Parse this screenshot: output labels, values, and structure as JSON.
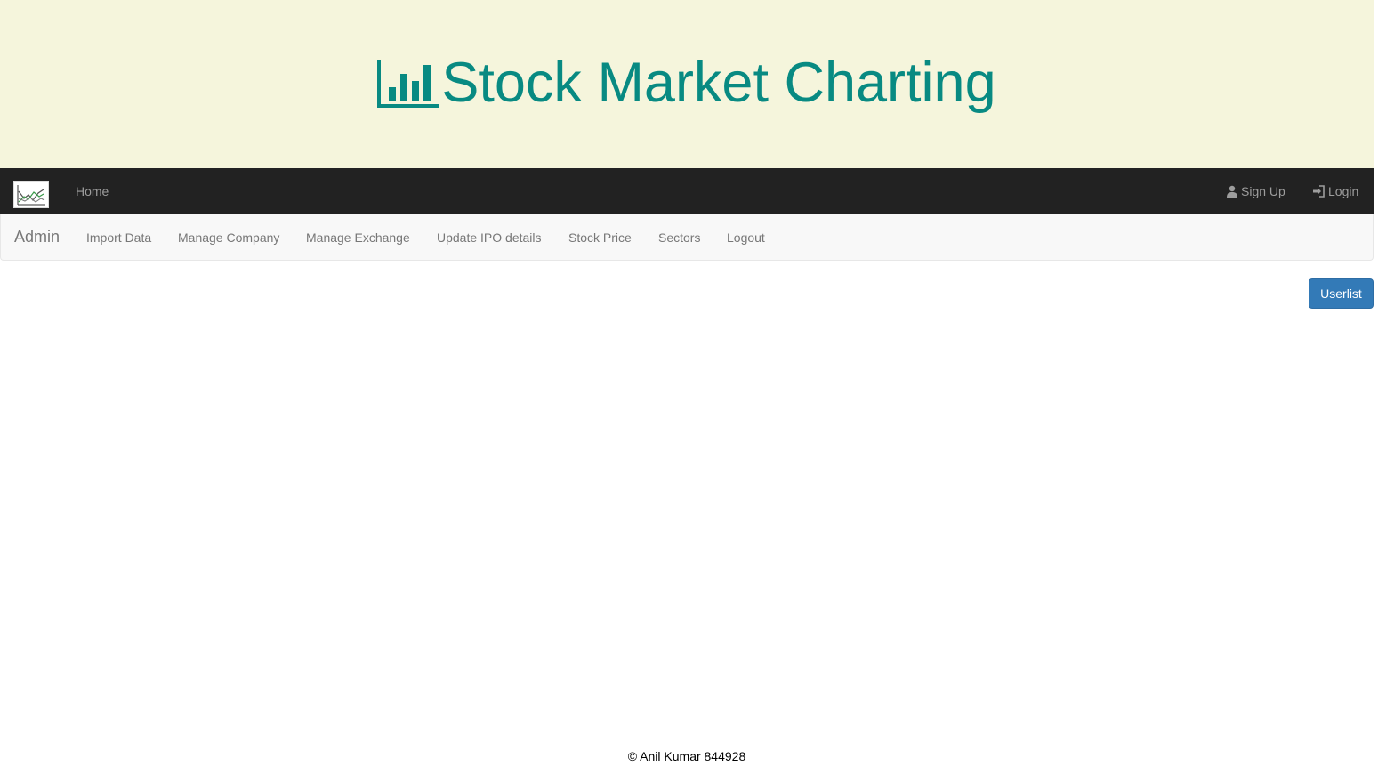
{
  "header": {
    "title": "Stock Market Charting",
    "title_icon": "bar-chart-icon",
    "title_color": "#088a82",
    "background": "#f5f5dc"
  },
  "topnav": {
    "logo": "stock-chart-logo",
    "home_label": "Home",
    "signup_label": "Sign Up",
    "signup_icon": "user-icon",
    "login_label": "Login",
    "login_icon": "log-in-icon",
    "background": "#222222"
  },
  "subnav": {
    "brand": "Admin",
    "items": [
      {
        "label": "Import Data"
      },
      {
        "label": "Manage Company"
      },
      {
        "label": "Manage Exchange"
      },
      {
        "label": "Update IPO details"
      },
      {
        "label": "Stock Price"
      },
      {
        "label": "Sectors"
      },
      {
        "label": "Logout"
      }
    ]
  },
  "main": {
    "userlist_button": "Userlist",
    "button_color": "#337ab7"
  },
  "footer": {
    "text": "© Anil Kumar 844928"
  }
}
